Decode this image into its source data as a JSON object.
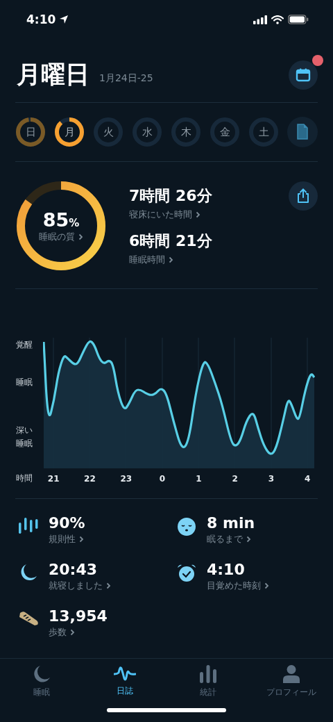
{
  "status_bar": {
    "time": "4:10"
  },
  "header": {
    "title": "月曜日",
    "date_range": "1月24日-25",
    "calendar_badge": true
  },
  "days": [
    {
      "label": "日",
      "level": 0.97,
      "selected": false
    },
    {
      "label": "月",
      "level": 0.88,
      "selected": true
    },
    {
      "label": "火",
      "selected": false
    },
    {
      "label": "水",
      "selected": false
    },
    {
      "label": "木",
      "selected": false
    },
    {
      "label": "金",
      "selected": false
    },
    {
      "label": "土",
      "selected": false
    }
  ],
  "quality": {
    "value": "85",
    "unit": "%",
    "label": "睡眠の質",
    "level": 0.85
  },
  "durations": [
    {
      "value": "7時間 26分",
      "label": "寝床にいた時間"
    },
    {
      "value": "6時間 21分",
      "label": "睡眠時間"
    }
  ],
  "sleep_chart": {
    "y_labels": [
      "覚醒",
      "睡眠",
      "深い睡眠"
    ],
    "x_title": "時間",
    "x_labels": [
      "21",
      "22",
      "23",
      "0",
      "1",
      "2",
      "3",
      "4"
    ]
  },
  "metrics": [
    {
      "kind": "regularity",
      "value": "90%",
      "label": "規則性"
    },
    {
      "kind": "latency",
      "value": "8 min",
      "label": "眠るまで"
    },
    {
      "kind": "bedtime",
      "value": "20:43",
      "label": "就寝しました"
    },
    {
      "kind": "wake",
      "value": "4:10",
      "label": "目覚めた時刻"
    },
    {
      "kind": "steps",
      "value": "13,954",
      "label": "歩数"
    }
  ],
  "tabs": [
    {
      "kind": "sleep",
      "label": "睡眠",
      "selected": false
    },
    {
      "kind": "journal",
      "label": "日誌",
      "selected": true
    },
    {
      "kind": "stats",
      "label": "統計",
      "selected": false
    },
    {
      "kind": "profile",
      "label": "プロフィール",
      "selected": false
    }
  ]
}
